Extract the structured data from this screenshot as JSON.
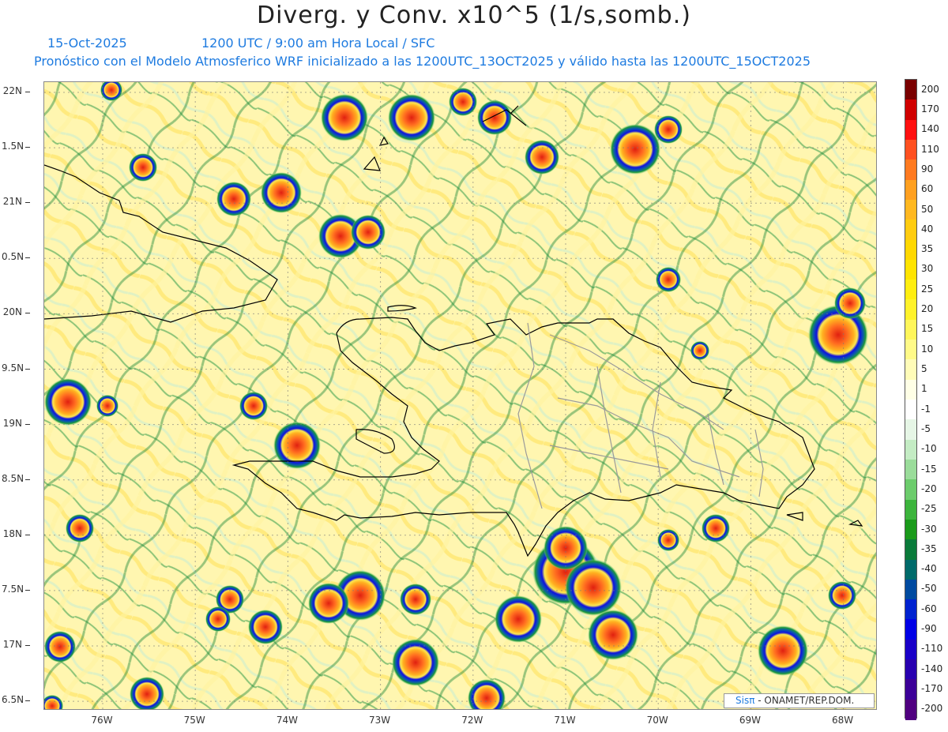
{
  "header": {
    "title": "Diverg. y Conv. x10^5 (1/s,somb.)",
    "date": "15-Oct-2025",
    "time_label": "1200 UTC / 9:00 am Hora Local / SFC",
    "description": "Pronóstico con el Modelo Atmosferico WRF inicializado a las 1200UTC_13OCT2025 y válido hasta las  1200UTC_15OCT2025"
  },
  "map": {
    "lat_labels": [
      "22N",
      "1.5N",
      "21N",
      "0.5N",
      "20N",
      "9.5N",
      "19N",
      "8.5N",
      "18N",
      "7.5N",
      "17N",
      "6.5N"
    ],
    "lon_labels": [
      "76W",
      "75W",
      "74W",
      "73W",
      "72W",
      "71W",
      "70W",
      "69W",
      "68W"
    ],
    "field": "divergence/convergence",
    "regions_shown": [
      "Cuba (east)",
      "Haiti",
      "Dominican Republic",
      "Bahamas",
      "Turks and Caicos"
    ]
  },
  "colorbar": {
    "labels": [
      "200",
      "170",
      "140",
      "110",
      "90",
      "60",
      "50",
      "40",
      "35",
      "30",
      "25",
      "20",
      "15",
      "10",
      "5",
      "1",
      "-1",
      "-5",
      "-10",
      "-15",
      "-20",
      "-25",
      "-30",
      "-35",
      "-40",
      "-50",
      "-60",
      "-90",
      "-110",
      "-140",
      "-170",
      "-200"
    ],
    "colors": [
      "#7a0000",
      "#d00000",
      "#ff1010",
      "#ff5020",
      "#ff7a20",
      "#ffa020",
      "#ffb820",
      "#ffcc10",
      "#ffd800",
      "#ffe400",
      "#ffee10",
      "#fff22a",
      "#fff65a",
      "#fffa88",
      "#fffcb8",
      "#ffffe6",
      "#ffffff",
      "#e6f6e6",
      "#c4ecc4",
      "#9adc9a",
      "#6ccc6c",
      "#3cb43c",
      "#1a9a1a",
      "#0a7a3a",
      "#006a6a",
      "#004aa0",
      "#0022d0",
      "#0000e6",
      "#1a00c8",
      "#2800b0",
      "#3c0098",
      "#500080"
    ]
  },
  "credit": {
    "brand": "Sisπ",
    "org": " - ONAMET/REP.DOM."
  }
}
